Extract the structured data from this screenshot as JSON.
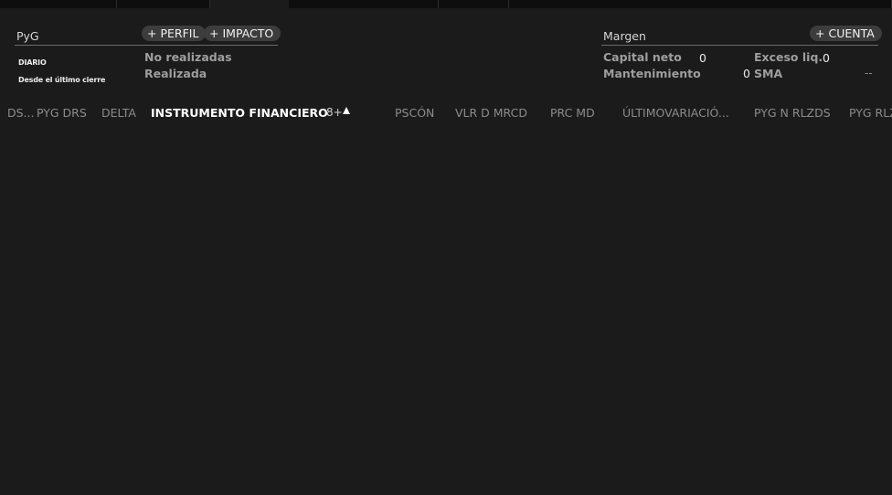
{
  "pyg": {
    "title": "PyG",
    "btn_perfil": "PERFIL",
    "btn_impacto": "IMPACTO",
    "diario": "DIARIO",
    "desde": "Desde el último cierre",
    "no_realizadas": "No realizadas",
    "realizada": "Realizada"
  },
  "margen": {
    "title": "Margen",
    "btn_cuenta": "CUENTA",
    "capital_neto_label": "Capital neto",
    "capital_neto_value": "0",
    "exceso_liq_label": "Exceso liq.",
    "exceso_liq_value": "0",
    "mantenimiento_label": "Mantenimiento",
    "mantenimiento_value": "0",
    "sma_label": "SMA",
    "sma_value": "--"
  },
  "plus_symbol": "+",
  "columns": {
    "ds": "DS...",
    "pyg_drs": "PYG DRS",
    "delta": "DELTA",
    "instrumento": "INSTRUMENTO FINANCIERO",
    "sort_extra": "8+",
    "pscon": "PSCÓN",
    "vlr": "VLR D MRCD",
    "prc": "PRC MD",
    "ultimo": "ÚLTIMOVARIACIÓ...",
    "pyg_n": "PYG N RLZDS",
    "pyg_rlz": "PYG RLZ"
  },
  "colors": {
    "background": "#1b1b1b",
    "pill": "#3d3d3d",
    "muted_text": "#8c8c8c",
    "bold_label": "#9e9e9e"
  }
}
